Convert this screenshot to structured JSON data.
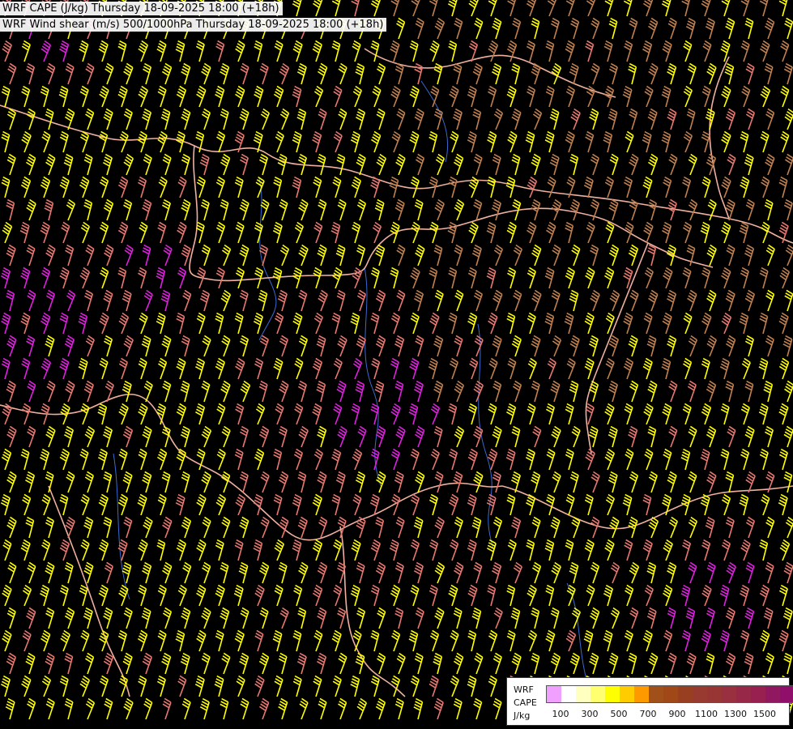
{
  "title": {
    "line1": "WRF CAPE (J/kg) Thursday 18-09-2025 18:00 (+18h)",
    "line2": "WRF Wind shear (m/s) 500/1000hPa Thursday 18-09-2025 18:00 (+18h)"
  },
  "legend": {
    "model": "WRF",
    "variable": "CAPE",
    "unit": "J/kg",
    "colors": [
      "#f0a0ff",
      "#ffffff",
      "#ffffc0",
      "#ffff70",
      "#ffff00",
      "#ffcc00",
      "#ff9900",
      "#a05018",
      "#a04818",
      "#983f22",
      "#983a30",
      "#983535",
      "#983040",
      "#982848",
      "#982050",
      "#901860",
      "#900f6a",
      "#900070",
      "#900075",
      "#900080"
    ],
    "tick_labels": [
      "100",
      "300",
      "500",
      "700",
      "900",
      "1100",
      "1300",
      "1500"
    ]
  },
  "map": {
    "barb_colors": {
      "low": "#ffff00",
      "mid": "#e87870",
      "brown": "#c08050",
      "high": "#e020e0"
    },
    "border_color": "#f0b0a0",
    "river_color": "#3a6ad0"
  }
}
